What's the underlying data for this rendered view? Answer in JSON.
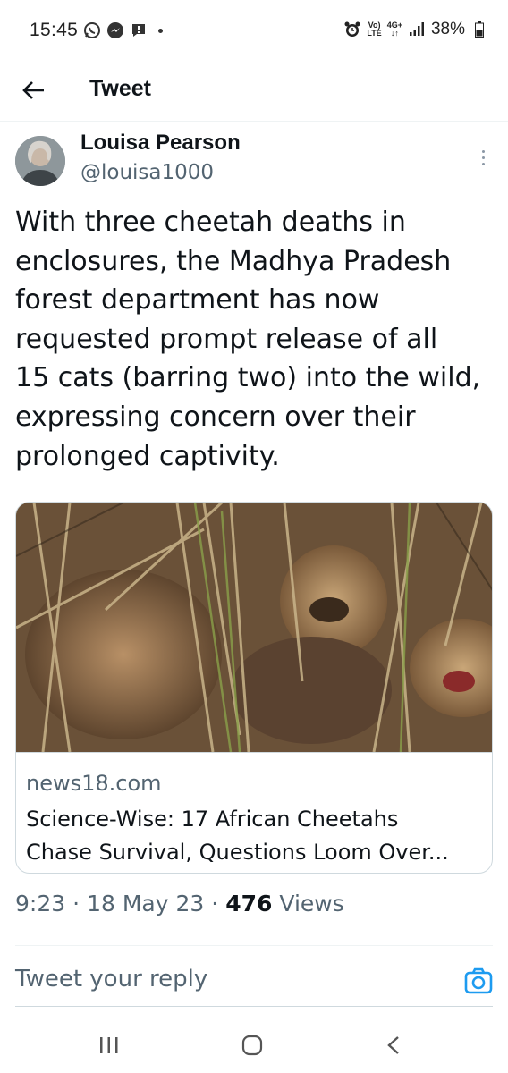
{
  "status_bar": {
    "time": "15:45",
    "left_icons": [
      "whatsapp-icon",
      "messenger-icon",
      "chat-icon",
      "dot-icon"
    ],
    "network_top": "Vo)",
    "network_bottom": "LTE",
    "network_type_top": "4G+",
    "network_type_bottom": "↓↑",
    "battery": "38%"
  },
  "header": {
    "back_icon": "arrow-left-icon",
    "title": "Tweet"
  },
  "tweet": {
    "author_name": "Louisa Pearson",
    "author_handle": "@louisa1000",
    "text_lines": [
      "With three cheetah deaths in",
      "enclosures, the Madhya Pradesh",
      "forest department has now",
      "requested prompt release of all",
      "15 cats (barring two) into the wild,",
      "expressing concern over their",
      "prolonged captivity."
    ],
    "card": {
      "domain": "news18.com",
      "title_line1": "Science-Wise: 17 African Cheetahs",
      "title_line2": "Chase Survival, Questions Loom Over..."
    },
    "time": "9:23",
    "date": "18 May 23",
    "views_count": "476",
    "views_label": "Views"
  },
  "reply": {
    "placeholder": "Tweet your reply",
    "camera_icon": "camera-icon"
  },
  "nav": {
    "items": [
      "recents-icon",
      "home-icon",
      "back-icon"
    ]
  },
  "colors": {
    "text_primary": "#0f1419",
    "text_secondary": "#536471",
    "accent": "#1d9bf0",
    "border": "#cfd9de"
  }
}
